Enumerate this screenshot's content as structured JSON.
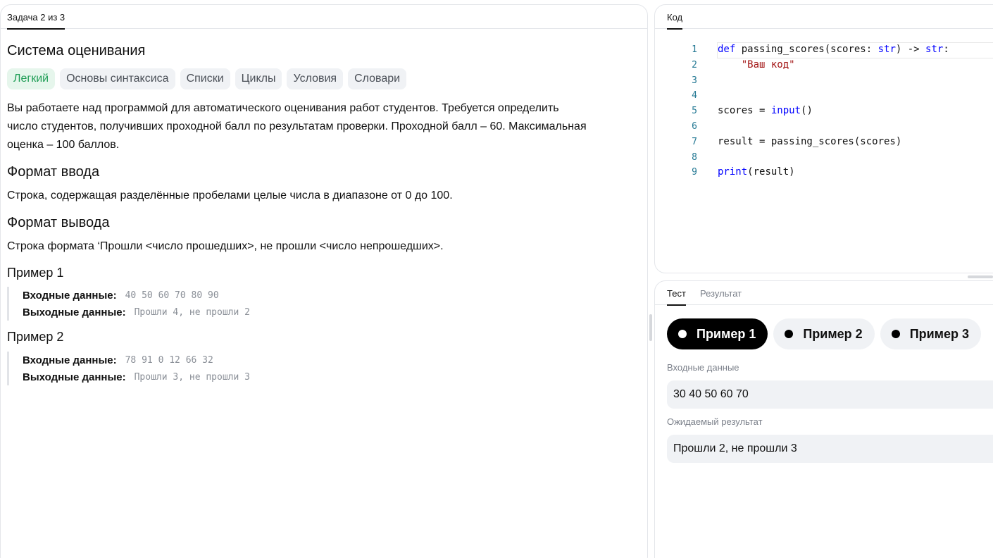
{
  "task": {
    "tab_label": "Задача 2 из 3",
    "title": "Система оценивания",
    "tags": [
      "Легкий",
      "Основы синтаксиса",
      "Списки",
      "Циклы",
      "Условия",
      "Словари"
    ],
    "description": [
      "Вы работаете над программой для автоматического оценивания работ студентов. Требуется определить",
      "число студентов, получивших проходной балл по результатам проверки. Проходной балл – 60. Максимальная",
      "оценка – 100 баллов."
    ],
    "input_format": {
      "title": "Формат ввода",
      "text": "Строка, содержащая разделённые пробелами целые числа в диапазоне от 0 до 100."
    },
    "output_format": {
      "title": "Формат вывода",
      "text": "Строка формата ‘Прошли <число прошедших>, не прошли <число непрошедших>."
    },
    "examples": [
      {
        "title": "Пример 1",
        "input_label": "Входные данные:",
        "input": "40 50 60 70 80 90",
        "output_label": "Выходные данные:",
        "output": "Прошли 4, не прошли 2"
      },
      {
        "title": "Пример 2",
        "input_label": "Входные данные:",
        "input": "78 91 0 12 66 32",
        "output_label": "Выходные данные:",
        "output": "Прошли 3, не прошли 3"
      }
    ]
  },
  "editor": {
    "tab_label": "Код",
    "lines": [
      {
        "n": "1",
        "code": "def passing_scores(scores: str) -> str:"
      },
      {
        "n": "2",
        "code": "    \"Ваш код\""
      },
      {
        "n": "3",
        "code": ""
      },
      {
        "n": "4",
        "code": ""
      },
      {
        "n": "5",
        "code": "scores = input()"
      },
      {
        "n": "6",
        "code": ""
      },
      {
        "n": "7",
        "code": "result = passing_scores(scores)"
      },
      {
        "n": "8",
        "code": ""
      },
      {
        "n": "9",
        "code": "print(result)"
      }
    ]
  },
  "tests": {
    "tabs": [
      "Тест",
      "Результат"
    ],
    "pills": [
      "Пример 1",
      "Пример 2",
      "Пример 3"
    ],
    "active_pill": "Пример 1",
    "input_label": "Входные данные",
    "input_value": "30 40 50 60 70",
    "expected_label": "Ожидаемый результат",
    "expected_value": "Прошли 2, не прошли 3"
  }
}
